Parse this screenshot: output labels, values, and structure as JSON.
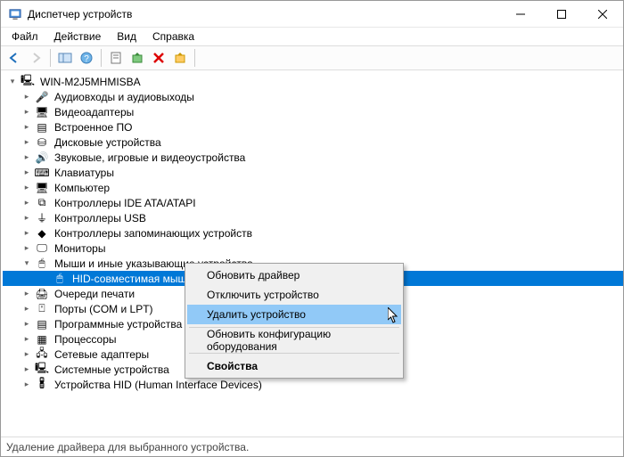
{
  "window": {
    "title": "Диспетчер устройств"
  },
  "menu": {
    "file": "Файл",
    "action": "Действие",
    "view": "Вид",
    "help": "Справка"
  },
  "tree": {
    "root": "WIN-M2J5MHMISBA",
    "nodes": [
      {
        "label": "Аудиовходы и аудиовыходы",
        "icon": "🎤"
      },
      {
        "label": "Видеоадаптеры",
        "icon": "🖥"
      },
      {
        "label": "Встроенное ПО",
        "icon": "▤"
      },
      {
        "label": "Дисковые устройства",
        "icon": "⛁"
      },
      {
        "label": "Звуковые, игровые и видеоустройства",
        "icon": "🔊"
      },
      {
        "label": "Клавиатуры",
        "icon": "⌨"
      },
      {
        "label": "Компьютер",
        "icon": "🖥"
      },
      {
        "label": "Контроллеры IDE ATA/ATAPI",
        "icon": "⧉"
      },
      {
        "label": "Контроллеры USB",
        "icon": "⏚"
      },
      {
        "label": "Контроллеры запоминающих устройств",
        "icon": "◆"
      },
      {
        "label": "Мониторы",
        "icon": "🖵"
      }
    ],
    "mice_category": "Мыши и иные указывающие устройства",
    "mice_icon": "🖱",
    "selected_device": "HID-совместимая мышь",
    "nodes_after": [
      {
        "label": "Очереди печати",
        "icon": "🖨"
      },
      {
        "label": "Порты (COM и LPT)",
        "icon": "⍞"
      },
      {
        "label": "Программные устройства",
        "icon": "▤"
      },
      {
        "label": "Процессоры",
        "icon": "▦"
      },
      {
        "label": "Сетевые адаптеры",
        "icon": "🖧"
      },
      {
        "label": "Системные устройства",
        "icon": "🖳"
      },
      {
        "label": "Устройства HID (Human Interface Devices)",
        "icon": "🖁"
      }
    ]
  },
  "context_menu": {
    "update": "Обновить драйвер",
    "disable": "Отключить устройство",
    "uninstall": "Удалить устройство",
    "scan": "Обновить конфигурацию оборудования",
    "properties": "Свойства"
  },
  "statusbar": {
    "text": "Удаление драйвера для выбранного устройства."
  }
}
